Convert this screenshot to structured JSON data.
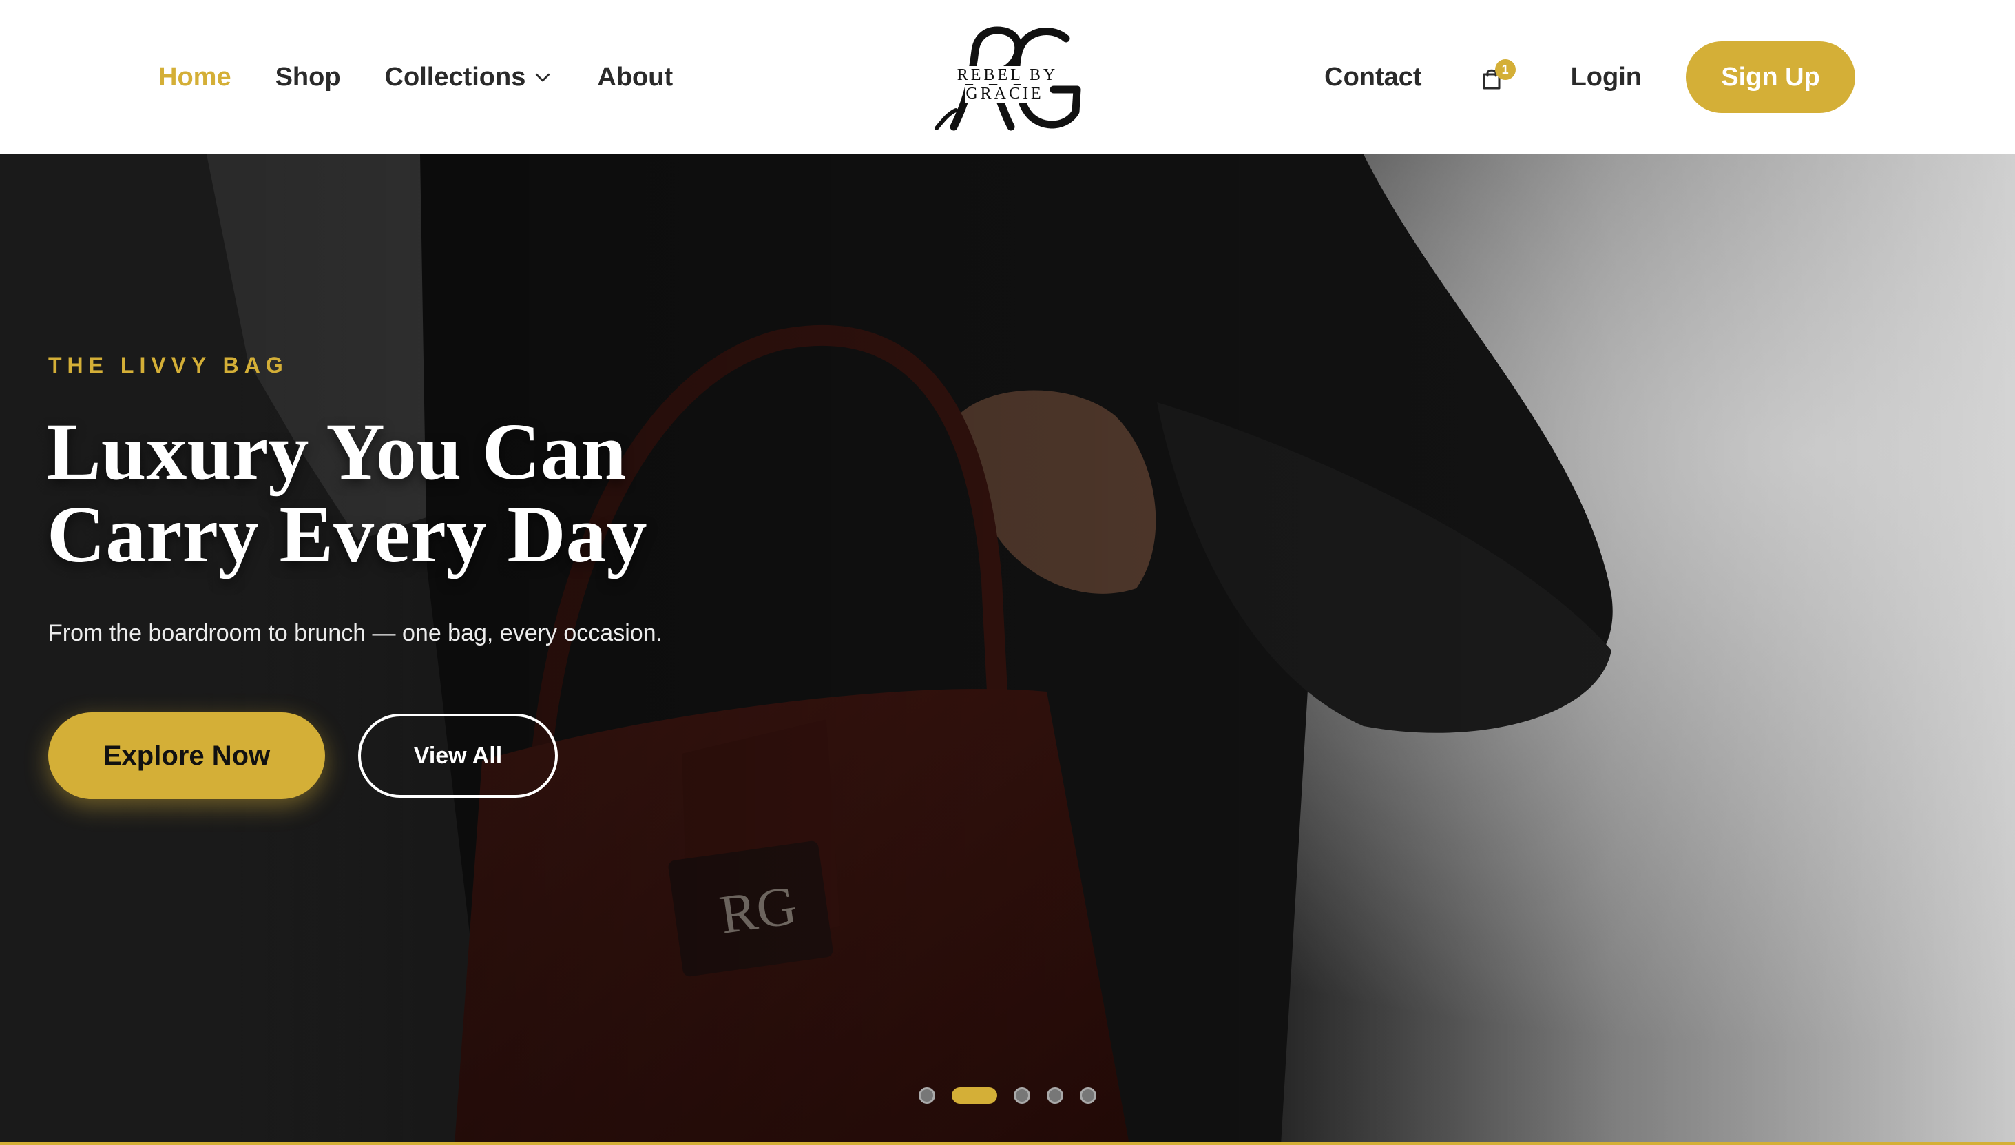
{
  "brand": {
    "name": "REBEL BY GRACIE",
    "monogram": "RG",
    "accent_color": "#d4af37"
  },
  "nav": {
    "home": "Home",
    "shop": "Shop",
    "collections": "Collections",
    "about": "About",
    "contact": "Contact",
    "login": "Login",
    "signup": "Sign Up",
    "active": "Home",
    "collections_icon": "chevron-down-icon"
  },
  "cart": {
    "icon": "shopping-bag-icon",
    "count": "1"
  },
  "hero": {
    "eyebrow": "THE LIVVY BAG",
    "title_line1": "Luxury You Can",
    "title_line2": "Carry Every Day",
    "subtitle": "From the boardroom to brunch — one bag, every occasion.",
    "primary_cta": "Explore Now",
    "secondary_cta": "View All"
  },
  "carousel": {
    "slide_count": 5,
    "active_slide": 2
  }
}
